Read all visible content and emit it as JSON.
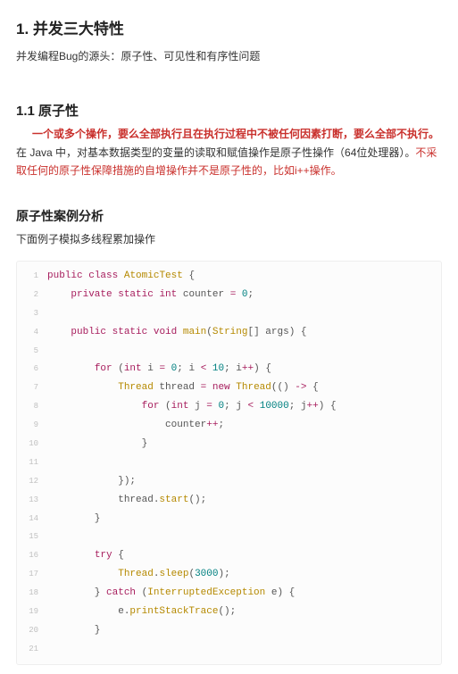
{
  "h1": "1. 并发三大特性",
  "intro": "并发编程Bug的源头：原子性、可见性和有序性问题",
  "h2": "1.1 原子性",
  "atomicity_para": {
    "red1": "一个或多个操作，要么全部执行且在执行过程中不被任何因素打断，要么全部不执行。",
    "mid": "在 Java 中，对基本数据类型的变量的读取和赋值操作是原子性操作（64位处理器）。",
    "red2": "不采取任何的原子性保障措施的自增操作并不是原子性的，比如i++操作。"
  },
  "h3": "原子性案例分析",
  "case_intro": "下面例子模拟多线程累加操作",
  "code": [
    [
      [
        "kw",
        "public"
      ],
      [
        "pln",
        " "
      ],
      [
        "kw",
        "class"
      ],
      [
        "pln",
        " "
      ],
      [
        "cls",
        "AtomicTest"
      ],
      [
        "pln",
        " {"
      ]
    ],
    [
      [
        "pln",
        "    "
      ],
      [
        "kw",
        "private"
      ],
      [
        "pln",
        " "
      ],
      [
        "kw",
        "static"
      ],
      [
        "pln",
        " "
      ],
      [
        "type",
        "int"
      ],
      [
        "pln",
        " counter "
      ],
      [
        "op",
        "="
      ],
      [
        "pln",
        " "
      ],
      [
        "num",
        "0"
      ],
      [
        "pln",
        ";"
      ]
    ],
    [],
    [
      [
        "pln",
        "    "
      ],
      [
        "kw",
        "public"
      ],
      [
        "pln",
        " "
      ],
      [
        "kw",
        "static"
      ],
      [
        "pln",
        " "
      ],
      [
        "type",
        "void"
      ],
      [
        "pln",
        " "
      ],
      [
        "fn",
        "main"
      ],
      [
        "pln",
        "("
      ],
      [
        "cls",
        "String"
      ],
      [
        "pln",
        "[] args) {"
      ]
    ],
    [],
    [
      [
        "pln",
        "        "
      ],
      [
        "kw",
        "for"
      ],
      [
        "pln",
        " ("
      ],
      [
        "type",
        "int"
      ],
      [
        "pln",
        " i "
      ],
      [
        "op",
        "="
      ],
      [
        "pln",
        " "
      ],
      [
        "num",
        "0"
      ],
      [
        "pln",
        "; i "
      ],
      [
        "op",
        "<"
      ],
      [
        "pln",
        " "
      ],
      [
        "num",
        "10"
      ],
      [
        "pln",
        "; i"
      ],
      [
        "op",
        "++"
      ],
      [
        "pln",
        ") {"
      ]
    ],
    [
      [
        "pln",
        "            "
      ],
      [
        "cls",
        "Thread"
      ],
      [
        "pln",
        " thread "
      ],
      [
        "op",
        "="
      ],
      [
        "pln",
        " "
      ],
      [
        "kw",
        "new"
      ],
      [
        "pln",
        " "
      ],
      [
        "cls",
        "Thread"
      ],
      [
        "pln",
        "(() "
      ],
      [
        "op",
        "->"
      ],
      [
        "pln",
        " {"
      ]
    ],
    [
      [
        "pln",
        "                "
      ],
      [
        "kw",
        "for"
      ],
      [
        "pln",
        " ("
      ],
      [
        "type",
        "int"
      ],
      [
        "pln",
        " j "
      ],
      [
        "op",
        "="
      ],
      [
        "pln",
        " "
      ],
      [
        "num",
        "0"
      ],
      [
        "pln",
        "; j "
      ],
      [
        "op",
        "<"
      ],
      [
        "pln",
        " "
      ],
      [
        "num",
        "10000"
      ],
      [
        "pln",
        "; j"
      ],
      [
        "op",
        "++"
      ],
      [
        "pln",
        ") {"
      ]
    ],
    [
      [
        "pln",
        "                    counter"
      ],
      [
        "op",
        "++"
      ],
      [
        "pln",
        ";"
      ]
    ],
    [
      [
        "pln",
        "                }"
      ]
    ],
    [],
    [
      [
        "pln",
        "            });"
      ]
    ],
    [
      [
        "pln",
        "            thread."
      ],
      [
        "fn",
        "start"
      ],
      [
        "pln",
        "();"
      ]
    ],
    [
      [
        "pln",
        "        }"
      ]
    ],
    [],
    [
      [
        "pln",
        "        "
      ],
      [
        "kw",
        "try"
      ],
      [
        "pln",
        " {"
      ]
    ],
    [
      [
        "pln",
        "            "
      ],
      [
        "cls",
        "Thread"
      ],
      [
        "pln",
        "."
      ],
      [
        "fn",
        "sleep"
      ],
      [
        "pln",
        "("
      ],
      [
        "num",
        "3000"
      ],
      [
        "pln",
        ");"
      ]
    ],
    [
      [
        "pln",
        "        } "
      ],
      [
        "kw",
        "catch"
      ],
      [
        "pln",
        " ("
      ],
      [
        "cls",
        "InterruptedException"
      ],
      [
        "pln",
        " e) {"
      ]
    ],
    [
      [
        "pln",
        "            e."
      ],
      [
        "fn",
        "printStackTrace"
      ],
      [
        "pln",
        "();"
      ]
    ],
    [
      [
        "pln",
        "        }"
      ]
    ],
    []
  ]
}
